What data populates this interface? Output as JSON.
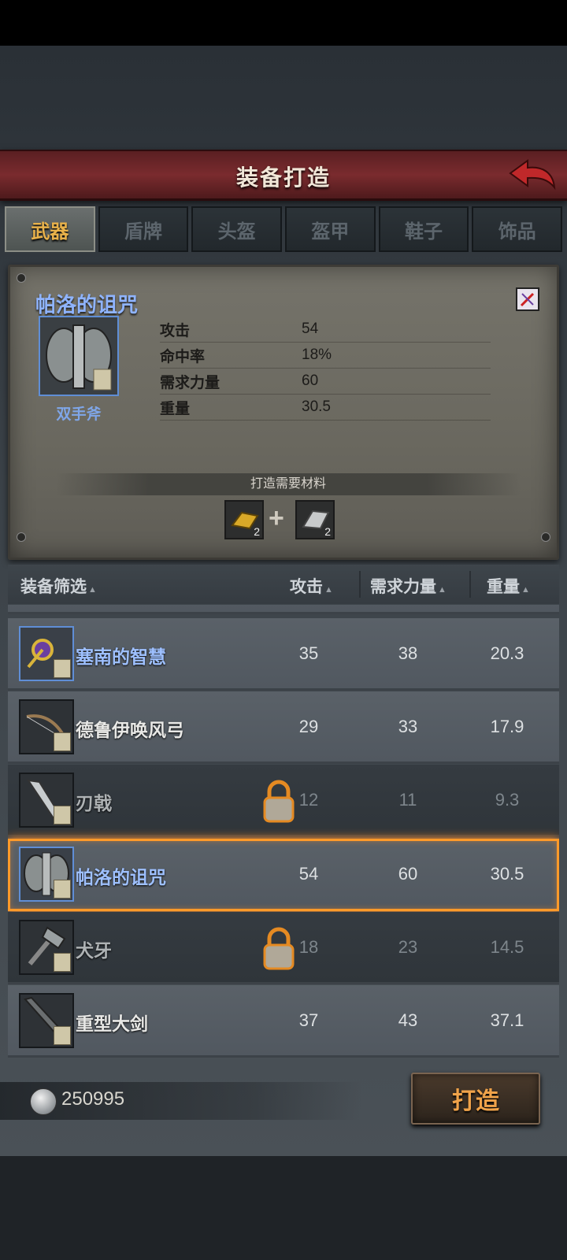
{
  "header": {
    "title": "装备打造"
  },
  "tabs": [
    {
      "label": "武器",
      "active": true
    },
    {
      "label": "盾牌",
      "active": false
    },
    {
      "label": "头盔",
      "active": false
    },
    {
      "label": "盔甲",
      "active": false
    },
    {
      "label": "鞋子",
      "active": false
    },
    {
      "label": "饰品",
      "active": false
    }
  ],
  "detail": {
    "name": "帕洛的诅咒",
    "type": "双手斧",
    "stats": [
      {
        "label": "攻击",
        "value": "54"
      },
      {
        "label": "命中率",
        "value": "18%"
      },
      {
        "label": "需求力量",
        "value": "60"
      },
      {
        "label": "重量",
        "value": "30.5"
      }
    ],
    "materials_label": "打造需要材料",
    "materials": [
      {
        "name": "gold-ingot-icon",
        "count": "2"
      },
      {
        "name": "silver-ingot-icon",
        "count": "2"
      }
    ]
  },
  "list_header": {
    "filter": "装备筛选",
    "attack": "攻击",
    "strength": "需求力量",
    "weight": "重量"
  },
  "items": [
    {
      "name": "塞南的智慧",
      "attack": "35",
      "strength": "38",
      "weight": "20.3",
      "icon": "staff-icon",
      "rarity": "blue",
      "locked": false
    },
    {
      "name": "德鲁伊唤风弓",
      "attack": "29",
      "strength": "33",
      "weight": "17.9",
      "icon": "bow-icon",
      "rarity": "normal",
      "locked": false
    },
    {
      "name": "刃戟",
      "attack": "12",
      "strength": "11",
      "weight": "9.3",
      "icon": "halberd-icon",
      "rarity": "normal",
      "locked": true
    },
    {
      "name": "帕洛的诅咒",
      "attack": "54",
      "strength": "60",
      "weight": "30.5",
      "icon": "axe-icon",
      "rarity": "blue",
      "locked": false,
      "selected": true
    },
    {
      "name": "犬牙",
      "attack": "18",
      "strength": "23",
      "weight": "14.5",
      "icon": "hammer-icon",
      "rarity": "normal",
      "locked": true
    },
    {
      "name": "重型大剑",
      "attack": "37",
      "strength": "43",
      "weight": "37.1",
      "icon": "greatsword-icon",
      "rarity": "normal",
      "locked": false
    }
  ],
  "footer": {
    "currency": "250995",
    "craft_label": "打造"
  }
}
